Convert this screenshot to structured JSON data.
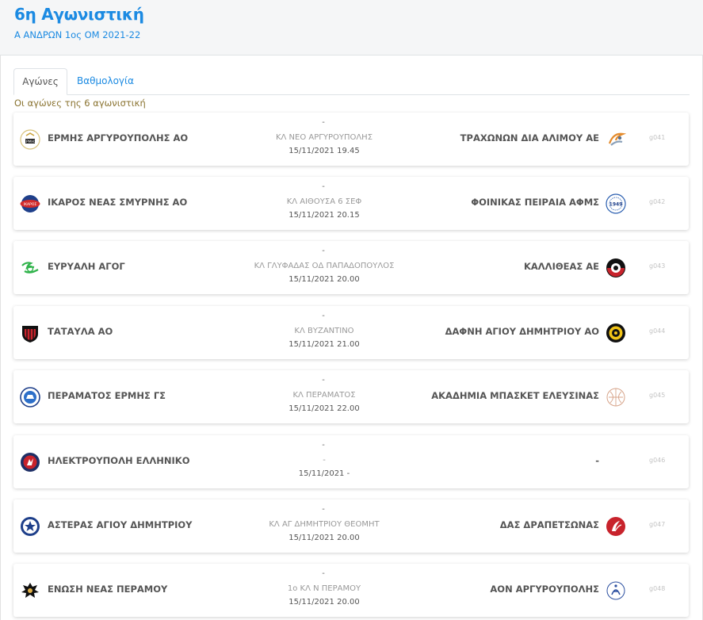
{
  "page": {
    "title": "6η Αγωνιστική",
    "subtitle": "Α ΑΝΔΡΩΝ 1ος ΟΜ 2021-22"
  },
  "tabs": [
    {
      "label": "Αγώνες",
      "active": true
    },
    {
      "label": "Βαθμολογία",
      "active": false
    }
  ],
  "caption": "Οι αγώνες της 6 αγωνιστική",
  "colors": {
    "accent": "#1b8ae2",
    "caption": "#8a7330",
    "muted": "#999999"
  },
  "matches": [
    {
      "home": "ΕΡΜΗΣ ΑΡΓΥΡΟΥΠΟΛΗΣ ΑΟ",
      "home_logo": "ermis-logo-icon",
      "score": "-",
      "venue": "ΚΛ ΝΕΟ ΑΡΓΥΡΟΥΠΟΛΗΣ",
      "datetime": "15/11/2021 19.45",
      "away": "ΤΡΑΧΩΝΩΝ ΔΙΑ ΑΛΙΜΟΥ ΑΕ",
      "away_logo": "trachones-logo-icon",
      "code": "g041"
    },
    {
      "home": "ΙΚΑΡΟΣ ΝΕΑΣ ΣΜΥΡΝΗΣ ΑΟ",
      "home_logo": "ikaros-logo-icon",
      "score": "-",
      "venue": "ΚΛ ΑΙΘΟΥΣΑ 6 ΣΕΦ",
      "datetime": "15/11/2021 20.15",
      "away": "ΦΟΙΝΙΚΑΣ ΠΕΙΡΑΙΑ ΑΦΜΣ",
      "away_logo": "foinikas-logo-icon",
      "code": "g042"
    },
    {
      "home": "ΕΥΡΥΑΛΗ ΑΓΟΓ",
      "home_logo": "evryali-logo-icon",
      "score": "-",
      "venue": "ΚΛ ΓΛΥΦΑΔΑΣ ΟΔ ΠΑΠΑΔΟΠΟΥΛΟΣ",
      "datetime": "15/11/2021 20.00",
      "away": "ΚΑΛΛΙΘΕΑΣ ΑΕ",
      "away_logo": "kallithea-logo-icon",
      "code": "g043"
    },
    {
      "home": "ΤΑΤΑΥΛΑ ΑΟ",
      "home_logo": "tatavla-logo-icon",
      "score": "-",
      "venue": "ΚΛ ΒΥΖΑΝΤΙΝΟ",
      "datetime": "15/11/2021 21.00",
      "away": "ΔΑΦΝΗ ΑΓΙΟΥ ΔΗΜΗΤΡΙΟΥ ΑΟ",
      "away_logo": "dafni-logo-icon",
      "code": "g044"
    },
    {
      "home": "ΠΕΡΑΜΑΤΟΣ ΕΡΜΗΣ ΓΣ",
      "home_logo": "peramatos-logo-icon",
      "score": "-",
      "venue": "ΚΛ ΠΕΡΑΜΑΤΟΣ",
      "datetime": "15/11/2021 22.00",
      "away": "ΑΚΑΔΗΜΙΑ ΜΠΑΣΚΕΤ ΕΛΕΥΣΙΝΑΣ",
      "away_logo": "akadimia-logo-icon",
      "code": "g045"
    },
    {
      "home": "ΗΛΕΚΤΡΟΥΠΟΛΗ ΕΛΛΗΝΙΚΟ",
      "home_logo": "ilektroupoli-logo-icon",
      "score": "-",
      "venue": "-",
      "datetime": "15/11/2021 -",
      "away": "-",
      "away_logo": "",
      "code": "g046"
    },
    {
      "home": "ΑΣΤΕΡΑΣ ΑΓΙΟΥ ΔΗΜΗΤΡΙΟΥ",
      "home_logo": "asteras-logo-icon",
      "score": "-",
      "venue": "ΚΛ ΑΓ ΔΗΜΗΤΡΙΟΥ ΘΕΟΜΗΤ",
      "datetime": "15/11/2021 20.00",
      "away": "ΔΑΣ ΔΡΑΠΕΤΣΩΝΑΣ",
      "away_logo": "das-logo-icon",
      "code": "g047"
    },
    {
      "home": "ΕΝΩΣΗ ΝΕΑΣ ΠΕΡΑΜΟΥ",
      "home_logo": "enosi-logo-icon",
      "score": "-",
      "venue": "1ο ΚΛ Ν ΠΕΡΑΜΟΥ",
      "datetime": "15/11/2021 20.00",
      "away": "ΑΟΝ ΑΡΓΥΡΟΥΠΟΛΗΣ",
      "away_logo": "aon-logo-icon",
      "code": "g048"
    }
  ]
}
